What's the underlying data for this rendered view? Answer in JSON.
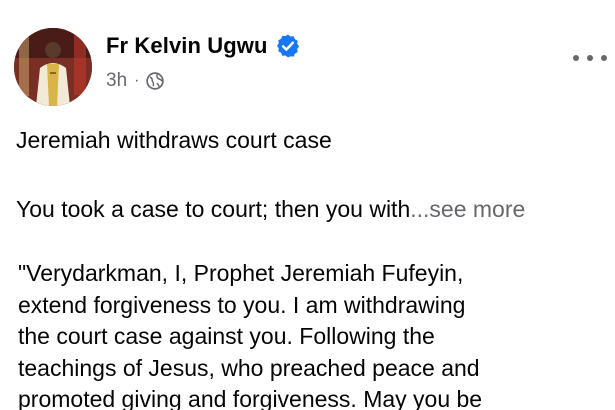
{
  "post": {
    "author_name": "Fr Kelvin Ugwu",
    "verified": true,
    "timestamp": "3h",
    "separator": "·",
    "privacy_icon": "globe-icon",
    "more_icon": "more-options-icon",
    "title": "Jeremiah withdraws court case",
    "teaser": "You took a case to court; then you with",
    "see_more_label": "...see more",
    "quote_lines": [
      "\"Verydarkman, I, Prophet Jeremiah Fufeyin,",
      "extend forgiveness to you. I am withdrawing",
      "the court case against you. Following the",
      "teachings of Jesus, who preached peace and",
      "promoted giving and forgiveness. May you be"
    ]
  },
  "colors": {
    "text_primary": "#050505",
    "text_secondary": "#65676b",
    "verified_badge": "#1877f2",
    "background": "#ffffff"
  }
}
